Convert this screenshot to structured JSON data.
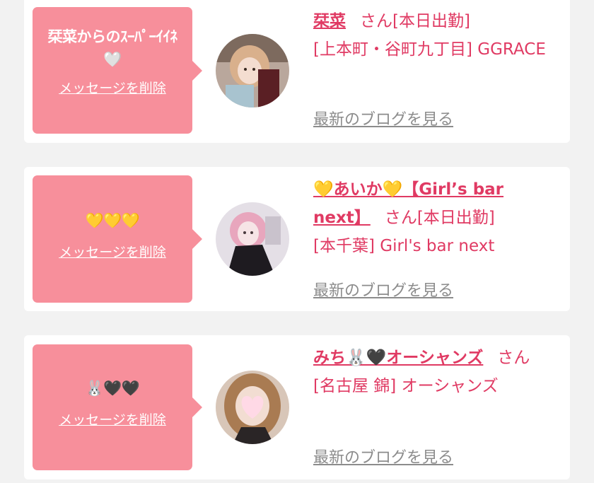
{
  "entries": [
    {
      "message": "栞菜からのｽｰﾊﾟｰｲｲﾈ🤍",
      "delete_label": "メッセージを削除",
      "name": "栞菜",
      "honorific": "さん",
      "status": "[本日出勤]",
      "shop": "[上本町・谷町九丁目] GGRACE",
      "blog_label": "最新のブログを見る",
      "avatar_icon": "girl-photo"
    },
    {
      "message": "💛💛💛",
      "delete_label": "メッセージを削除",
      "name": "💛あいか💛【Girl’s bar next】",
      "honorific": "さん",
      "status": "[本日出勤]",
      "shop": "[本千葉] Girl's bar next",
      "blog_label": "最新のブログを見る",
      "avatar_icon": "girl-photo"
    },
    {
      "message": "🐰🖤🖤",
      "delete_label": "メッセージを削除",
      "name": "みち🐰🖤オーシャンズ",
      "honorific": "さん",
      "status": "",
      "shop": "[名古屋 錦] オーシャンズ",
      "blog_label": "最新のブログを見る",
      "avatar_icon": "girl-photo-heart-mask"
    }
  ],
  "colors": {
    "bubble": "#f78f9b",
    "accent": "#e03a63",
    "link_gray": "#8c8c8c",
    "background": "#f2f2f2"
  }
}
